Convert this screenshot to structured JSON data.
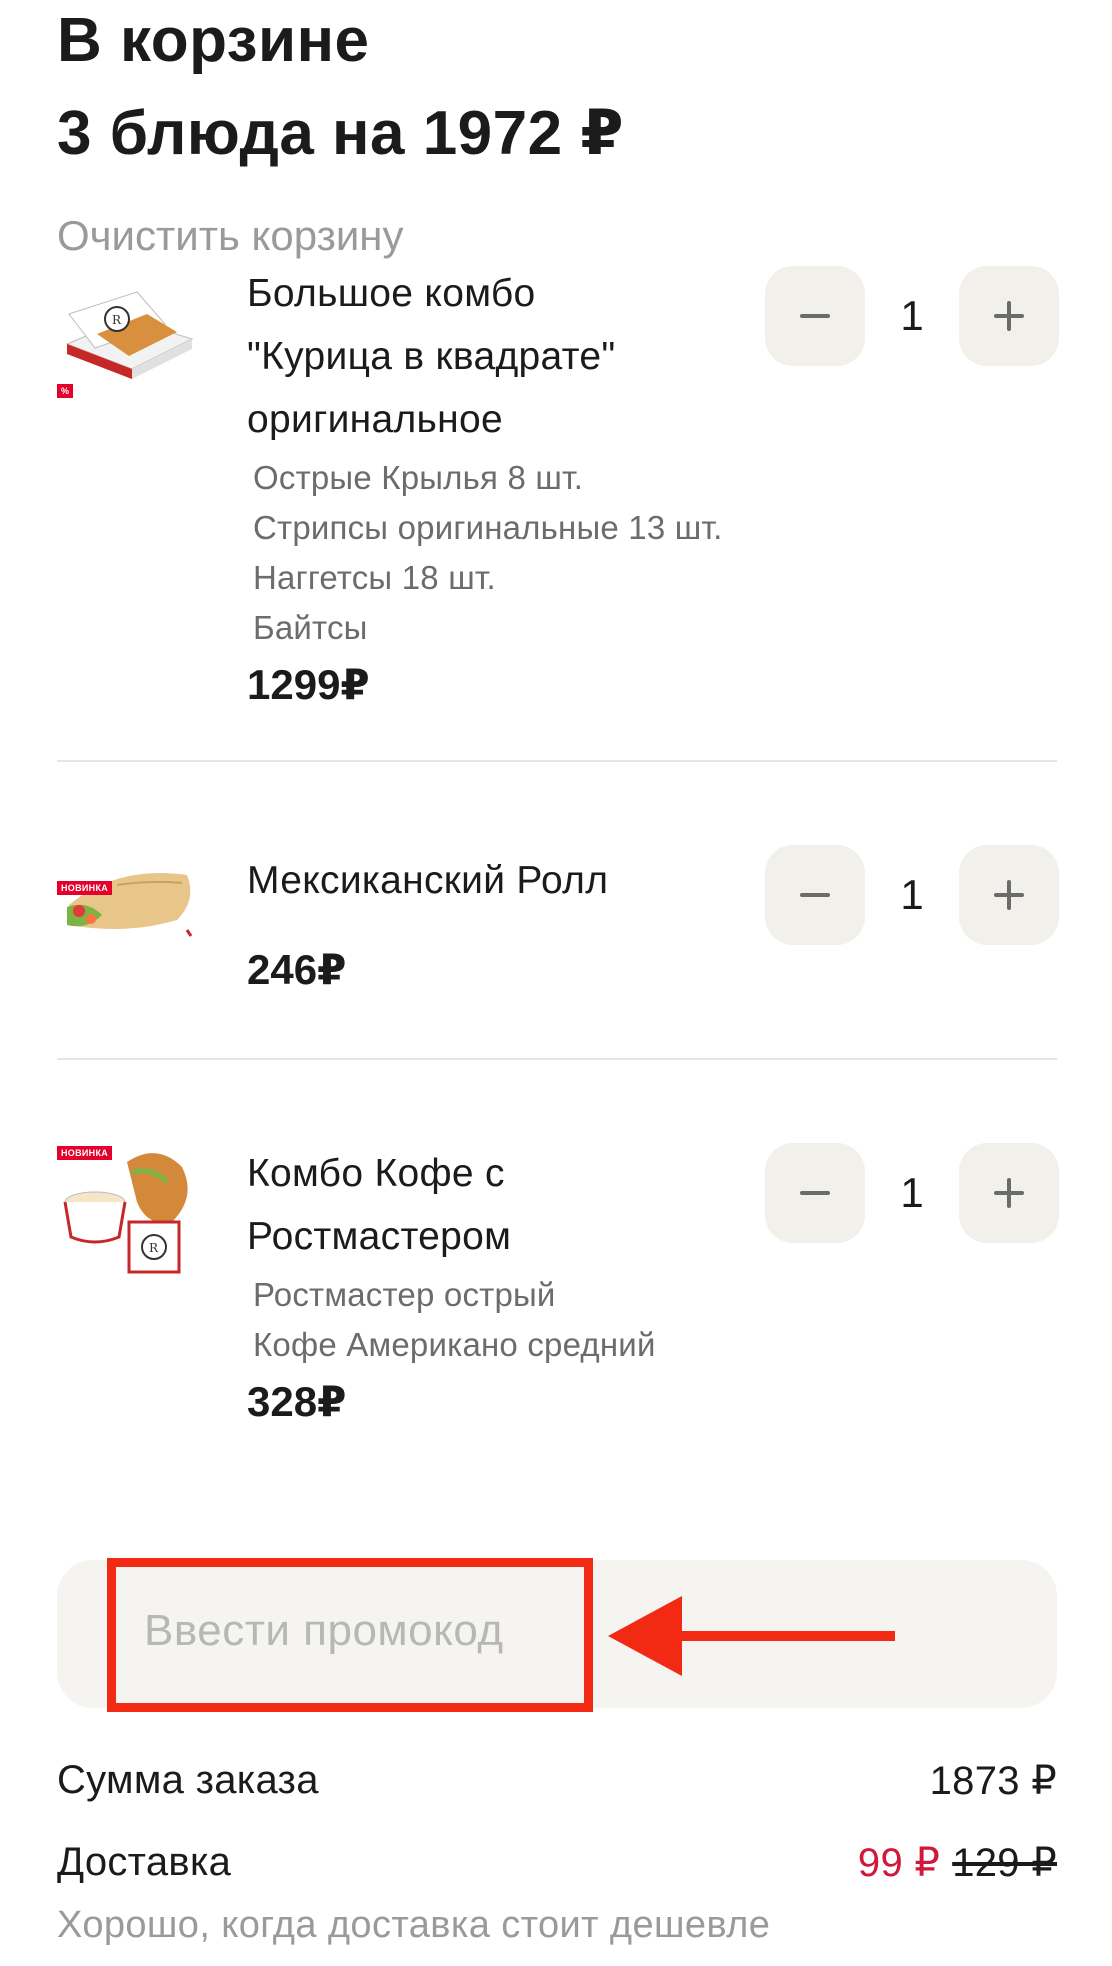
{
  "header": {
    "title_line1": "В корзине",
    "title_line2": "3 блюда на 1972 ₽",
    "clear_label": "Очистить корзину"
  },
  "items": [
    {
      "name_lines": [
        "Большое комбо",
        "\"Курица в квадрате\"",
        "оригинальное"
      ],
      "modifiers": [
        "Острые Крылья 8 шт.",
        "Стрипсы оригинальные 13 шт.",
        "Наггетсы 18 шт.",
        "Байтсы"
      ],
      "price": "1299₽",
      "quantity": "1",
      "badge": "%"
    },
    {
      "name_lines": [
        "Мексиканский Ролл"
      ],
      "modifiers": [],
      "price": "246₽",
      "quantity": "1",
      "badge": "НОВИНКА"
    },
    {
      "name_lines": [
        "Комбо Кофе с",
        "Ростмастером"
      ],
      "modifiers": [
        "Ростмастер острый",
        "Кофе Американо средний"
      ],
      "price": "328₽",
      "quantity": "1",
      "badge": "НОВИНКА"
    }
  ],
  "promo": {
    "placeholder": "Ввести промокод"
  },
  "summary": {
    "order_sum_label": "Сумма заказа",
    "order_sum_value": "1873 ₽",
    "delivery_label": "Доставка",
    "delivery_price": "99 ₽",
    "delivery_old_price": "129 ₽",
    "delivery_hint": "Хорошо, когда доставка стоит дешевле"
  },
  "colors": {
    "accent_red": "#d2173d",
    "annotation_red": "#f22a14",
    "button_bg": "#f2f0ea"
  }
}
